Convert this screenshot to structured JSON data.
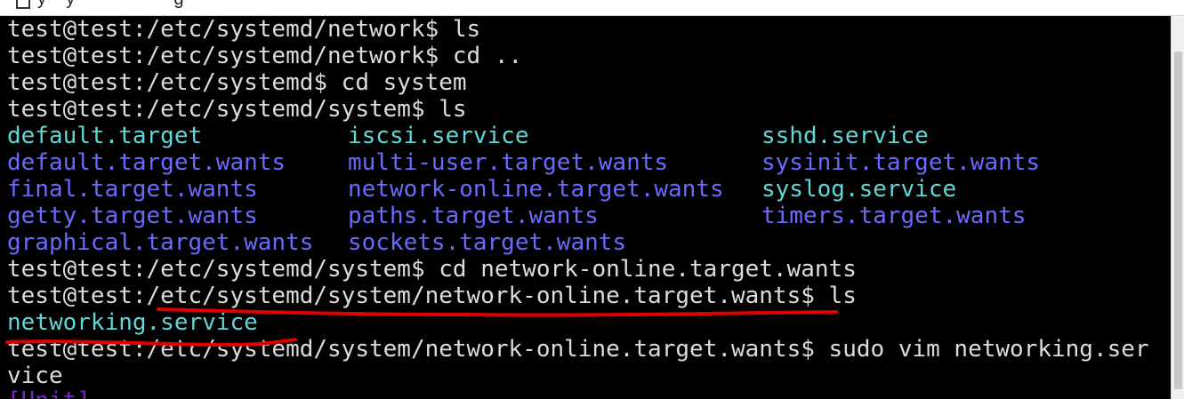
{
  "window": {
    "title_fragment": "y    y                    g",
    "icon": "document-icon"
  },
  "terminal": {
    "prompt_lines": [
      "test@test:/etc/systemd/network$ ls",
      "test@test:/etc/systemd/network$ cd ..",
      "test@test:/etc/systemd$ cd system",
      "test@test:/etc/systemd/system$ ls"
    ],
    "listing": {
      "col1": [
        {
          "name": "default.target",
          "kind": "exec"
        },
        {
          "name": "default.target.wants",
          "kind": "dir"
        },
        {
          "name": "final.target.wants",
          "kind": "dir"
        },
        {
          "name": "getty.target.wants",
          "kind": "dir"
        },
        {
          "name": "graphical.target.wants",
          "kind": "dir"
        }
      ],
      "col2": [
        {
          "name": "iscsi.service",
          "kind": "exec"
        },
        {
          "name": "multi-user.target.wants",
          "kind": "dir"
        },
        {
          "name": "network-online.target.wants",
          "kind": "dir"
        },
        {
          "name": "paths.target.wants",
          "kind": "dir"
        },
        {
          "name": "sockets.target.wants",
          "kind": "dir"
        }
      ],
      "col3": [
        {
          "name": "sshd.service",
          "kind": "exec"
        },
        {
          "name": "sysinit.target.wants",
          "kind": "dir"
        },
        {
          "name": "syslog.service",
          "kind": "exec"
        },
        {
          "name": "timers.target.wants",
          "kind": "dir"
        },
        {
          "name": "",
          "kind": "dir"
        }
      ]
    },
    "after_lines": [
      "test@test:/etc/systemd/system$ cd network-online.target.wants",
      "test@test:/etc/systemd/system/network-online.target.wants$ ls"
    ],
    "networking_entry": "networking.service",
    "vim_line": "test@test:/etc/systemd/system/network-online.target.wants$ sudo vim networking.ser",
    "vim_line_wrap": "vice",
    "cut_off_line": "[Unit]"
  },
  "colors": {
    "background": "#000000",
    "text": "#dcdcdc",
    "executable": "#5fd7d7",
    "directory": "#6a6aff",
    "annotation": "#e00000"
  }
}
